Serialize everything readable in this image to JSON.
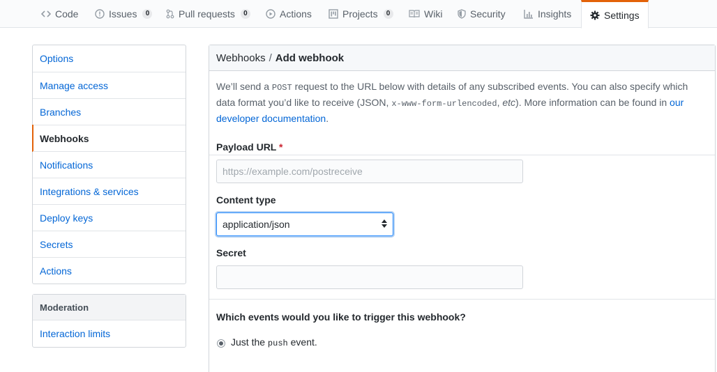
{
  "tabs": [
    {
      "label": "Code",
      "icon": "code-icon"
    },
    {
      "label": "Issues",
      "icon": "issue-icon",
      "count": "0"
    },
    {
      "label": "Pull requests",
      "icon": "pull-request-icon",
      "count": "0"
    },
    {
      "label": "Actions",
      "icon": "play-icon"
    },
    {
      "label": "Projects",
      "icon": "project-icon",
      "count": "0"
    },
    {
      "label": "Wiki",
      "icon": "book-icon"
    },
    {
      "label": "Security",
      "icon": "shield-icon"
    },
    {
      "label": "Insights",
      "icon": "graph-icon"
    },
    {
      "label": "Settings",
      "icon": "gear-icon",
      "selected": true
    }
  ],
  "sidebar": {
    "items": [
      {
        "label": "Options"
      },
      {
        "label": "Manage access"
      },
      {
        "label": "Branches"
      },
      {
        "label": "Webhooks",
        "selected": true
      },
      {
        "label": "Notifications"
      },
      {
        "label": "Integrations & services"
      },
      {
        "label": "Deploy keys"
      },
      {
        "label": "Secrets"
      },
      {
        "label": "Actions"
      }
    ],
    "moderation": {
      "heading": "Moderation",
      "items": [
        {
          "label": "Interaction limits"
        }
      ]
    }
  },
  "main": {
    "breadcrumb": {
      "parent": "Webhooks",
      "separator": "/",
      "current": "Add webhook"
    },
    "intro": {
      "part1": "We’ll send a ",
      "code1": "POST",
      "part2": " request to the URL below with details of any subscribed events. You can also specify which data format you’d like to receive (JSON, ",
      "code2": "x-www-form-urlencoded",
      "part3": ", ",
      "etc": "etc",
      "part4": "). More information can be found in ",
      "link": "our developer documentation",
      "part5": "."
    },
    "payload_url": {
      "label": "Payload URL",
      "required_mark": "*",
      "placeholder": "https://example.com/postreceive",
      "value": ""
    },
    "content_type": {
      "label": "Content type",
      "selected": "application/json"
    },
    "secret": {
      "label": "Secret",
      "value": ""
    },
    "events": {
      "question": "Which events would you like to trigger this webhook?",
      "option1_pre": "Just the ",
      "option1_code": "push",
      "option1_post": " event."
    }
  },
  "colors": {
    "accent": "#e36209",
    "link": "#0366d6",
    "focus": "#2188ff",
    "required": "#cb2431"
  }
}
